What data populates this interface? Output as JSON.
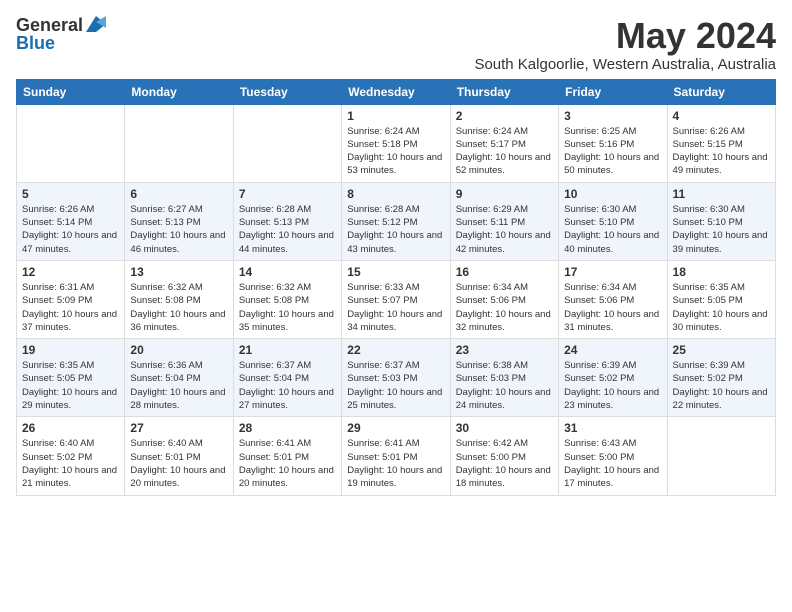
{
  "logo": {
    "general": "General",
    "blue": "Blue"
  },
  "title": "May 2024",
  "location": "South Kalgoorlie, Western Australia, Australia",
  "days_of_week": [
    "Sunday",
    "Monday",
    "Tuesday",
    "Wednesday",
    "Thursday",
    "Friday",
    "Saturday"
  ],
  "weeks": [
    [
      {
        "day": "",
        "info": ""
      },
      {
        "day": "",
        "info": ""
      },
      {
        "day": "",
        "info": ""
      },
      {
        "day": "1",
        "info": "Sunrise: 6:24 AM\nSunset: 5:18 PM\nDaylight: 10 hours and 53 minutes."
      },
      {
        "day": "2",
        "info": "Sunrise: 6:24 AM\nSunset: 5:17 PM\nDaylight: 10 hours and 52 minutes."
      },
      {
        "day": "3",
        "info": "Sunrise: 6:25 AM\nSunset: 5:16 PM\nDaylight: 10 hours and 50 minutes."
      },
      {
        "day": "4",
        "info": "Sunrise: 6:26 AM\nSunset: 5:15 PM\nDaylight: 10 hours and 49 minutes."
      }
    ],
    [
      {
        "day": "5",
        "info": "Sunrise: 6:26 AM\nSunset: 5:14 PM\nDaylight: 10 hours and 47 minutes."
      },
      {
        "day": "6",
        "info": "Sunrise: 6:27 AM\nSunset: 5:13 PM\nDaylight: 10 hours and 46 minutes."
      },
      {
        "day": "7",
        "info": "Sunrise: 6:28 AM\nSunset: 5:13 PM\nDaylight: 10 hours and 44 minutes."
      },
      {
        "day": "8",
        "info": "Sunrise: 6:28 AM\nSunset: 5:12 PM\nDaylight: 10 hours and 43 minutes."
      },
      {
        "day": "9",
        "info": "Sunrise: 6:29 AM\nSunset: 5:11 PM\nDaylight: 10 hours and 42 minutes."
      },
      {
        "day": "10",
        "info": "Sunrise: 6:30 AM\nSunset: 5:10 PM\nDaylight: 10 hours and 40 minutes."
      },
      {
        "day": "11",
        "info": "Sunrise: 6:30 AM\nSunset: 5:10 PM\nDaylight: 10 hours and 39 minutes."
      }
    ],
    [
      {
        "day": "12",
        "info": "Sunrise: 6:31 AM\nSunset: 5:09 PM\nDaylight: 10 hours and 37 minutes."
      },
      {
        "day": "13",
        "info": "Sunrise: 6:32 AM\nSunset: 5:08 PM\nDaylight: 10 hours and 36 minutes."
      },
      {
        "day": "14",
        "info": "Sunrise: 6:32 AM\nSunset: 5:08 PM\nDaylight: 10 hours and 35 minutes."
      },
      {
        "day": "15",
        "info": "Sunrise: 6:33 AM\nSunset: 5:07 PM\nDaylight: 10 hours and 34 minutes."
      },
      {
        "day": "16",
        "info": "Sunrise: 6:34 AM\nSunset: 5:06 PM\nDaylight: 10 hours and 32 minutes."
      },
      {
        "day": "17",
        "info": "Sunrise: 6:34 AM\nSunset: 5:06 PM\nDaylight: 10 hours and 31 minutes."
      },
      {
        "day": "18",
        "info": "Sunrise: 6:35 AM\nSunset: 5:05 PM\nDaylight: 10 hours and 30 minutes."
      }
    ],
    [
      {
        "day": "19",
        "info": "Sunrise: 6:35 AM\nSunset: 5:05 PM\nDaylight: 10 hours and 29 minutes."
      },
      {
        "day": "20",
        "info": "Sunrise: 6:36 AM\nSunset: 5:04 PM\nDaylight: 10 hours and 28 minutes."
      },
      {
        "day": "21",
        "info": "Sunrise: 6:37 AM\nSunset: 5:04 PM\nDaylight: 10 hours and 27 minutes."
      },
      {
        "day": "22",
        "info": "Sunrise: 6:37 AM\nSunset: 5:03 PM\nDaylight: 10 hours and 25 minutes."
      },
      {
        "day": "23",
        "info": "Sunrise: 6:38 AM\nSunset: 5:03 PM\nDaylight: 10 hours and 24 minutes."
      },
      {
        "day": "24",
        "info": "Sunrise: 6:39 AM\nSunset: 5:02 PM\nDaylight: 10 hours and 23 minutes."
      },
      {
        "day": "25",
        "info": "Sunrise: 6:39 AM\nSunset: 5:02 PM\nDaylight: 10 hours and 22 minutes."
      }
    ],
    [
      {
        "day": "26",
        "info": "Sunrise: 6:40 AM\nSunset: 5:02 PM\nDaylight: 10 hours and 21 minutes."
      },
      {
        "day": "27",
        "info": "Sunrise: 6:40 AM\nSunset: 5:01 PM\nDaylight: 10 hours and 20 minutes."
      },
      {
        "day": "28",
        "info": "Sunrise: 6:41 AM\nSunset: 5:01 PM\nDaylight: 10 hours and 20 minutes."
      },
      {
        "day": "29",
        "info": "Sunrise: 6:41 AM\nSunset: 5:01 PM\nDaylight: 10 hours and 19 minutes."
      },
      {
        "day": "30",
        "info": "Sunrise: 6:42 AM\nSunset: 5:00 PM\nDaylight: 10 hours and 18 minutes."
      },
      {
        "day": "31",
        "info": "Sunrise: 6:43 AM\nSunset: 5:00 PM\nDaylight: 10 hours and 17 minutes."
      },
      {
        "day": "",
        "info": ""
      }
    ]
  ]
}
